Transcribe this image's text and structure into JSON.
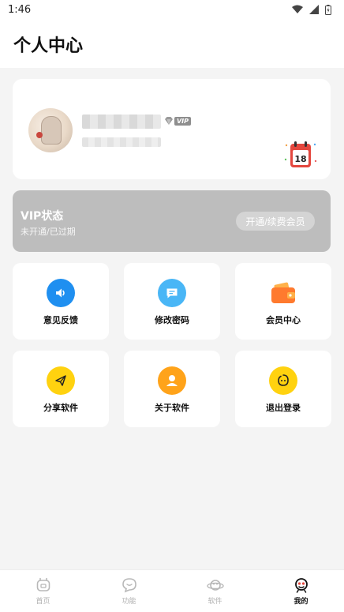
{
  "status_bar": {
    "time": "1:46"
  },
  "header": {
    "title": "个人中心"
  },
  "profile": {
    "vip_badge": "VIP",
    "calendar_day": "18"
  },
  "vip_card": {
    "title": "VIP状态",
    "status": "未开通/已过期",
    "button_label": "开通/续费会员"
  },
  "tiles": [
    {
      "label": "意见反馈",
      "icon": "speaker-icon",
      "color": "#1f8ff0"
    },
    {
      "label": "修改密码",
      "icon": "message-icon",
      "color": "#49b6f6"
    },
    {
      "label": "会员中心",
      "icon": "wallet-icon",
      "color": "#ff7a2e"
    },
    {
      "label": "分享软件",
      "icon": "paper-plane-icon",
      "color": "#ffd20f"
    },
    {
      "label": "关于软件",
      "icon": "person-icon",
      "color": "#ffa31a"
    },
    {
      "label": "退出登录",
      "icon": "face-icon",
      "color": "#ffd20f"
    }
  ],
  "tabbar": {
    "items": [
      {
        "label": "首页",
        "icon": "home-icon"
      },
      {
        "label": "功能",
        "icon": "chat-bubble-icon"
      },
      {
        "label": "软件",
        "icon": "planet-icon"
      },
      {
        "label": "我的",
        "icon": "profile-icon",
        "active": true
      }
    ]
  }
}
